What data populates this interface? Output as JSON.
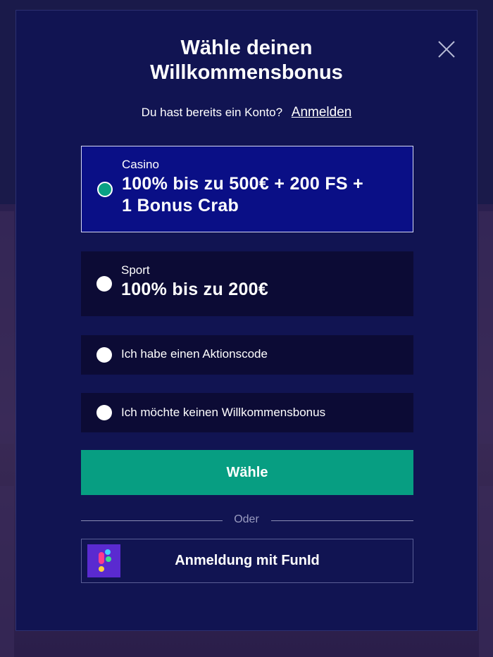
{
  "modal": {
    "title_line1": "Wähle deinen",
    "title_line2": "Willkommensbonus",
    "close_icon": "close-icon"
  },
  "login": {
    "prompt": "Du hast bereits ein Konto?",
    "link_label": "Anmelden"
  },
  "options": [
    {
      "label": "Casino",
      "value_line1": "100% bis zu 500€ + 200 FS +",
      "value_line2": "1 Bonus Crab",
      "selected": true
    },
    {
      "label": "Sport",
      "value_line1": "100% bis zu 200€",
      "selected": false
    },
    {
      "label": "Ich habe einen Aktionscode",
      "selected": false
    },
    {
      "label": "Ich möchte keinen Willkommensbonus",
      "selected": false
    }
  ],
  "submit_label": "Wähle",
  "divider_label": "Oder",
  "funid": {
    "label": "Anmeldung mit FunId",
    "logo_icon": "funid-logo-icon"
  },
  "colors": {
    "modal_bg": "#111452",
    "selected_option_bg": "#0a0f86",
    "option_bg": "#0c0b35",
    "accent_green": "#079e82"
  }
}
